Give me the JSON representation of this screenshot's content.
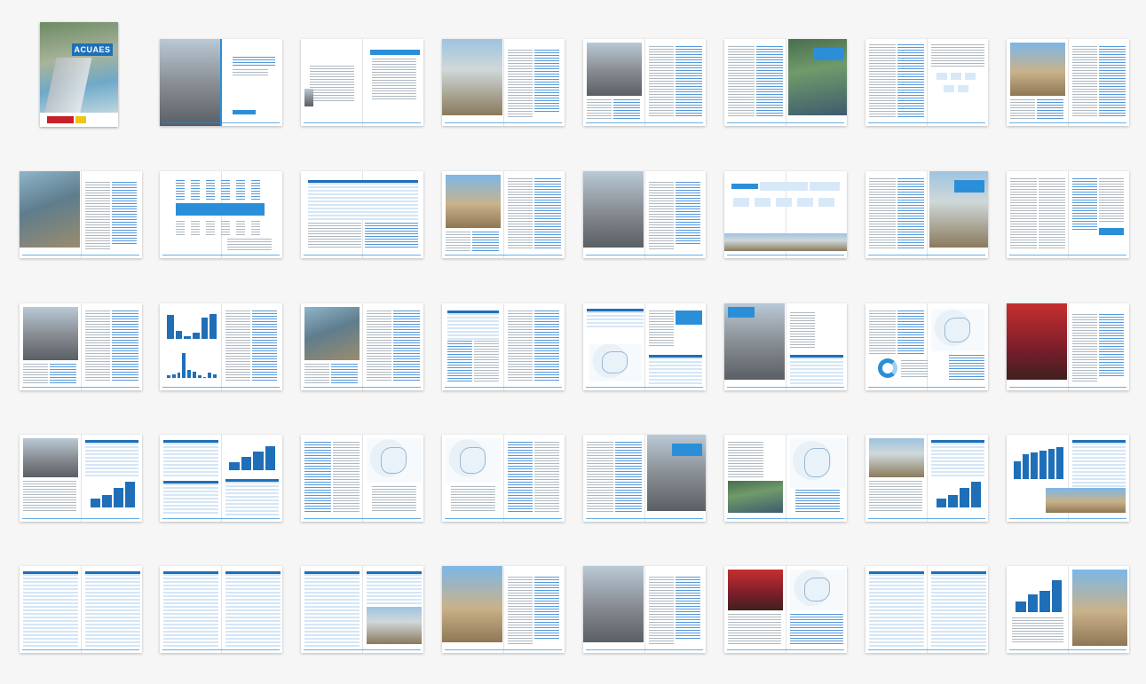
{
  "cover": {
    "logo_text": "ACUAES"
  },
  "spreads": [
    {
      "kind": "title"
    },
    {
      "kind": "toc"
    },
    {
      "kind": "photoText",
      "photo": "b"
    },
    {
      "kind": "photoLeft",
      "photo": "d"
    },
    {
      "kind": "textPhoto",
      "photo": "c"
    },
    {
      "kind": "diagram"
    },
    {
      "kind": "photoLeft",
      "photo": "e"
    },
    {
      "kind": "photoText",
      "photo": "a"
    },
    {
      "kind": "infographic"
    },
    {
      "kind": "bigTable"
    },
    {
      "kind": "photoLeft",
      "photo": "e"
    },
    {
      "kind": "photoText",
      "photo": "d"
    },
    {
      "kind": "orgChart"
    },
    {
      "kind": "textPhoto",
      "photo": "b"
    },
    {
      "kind": "textOnly"
    },
    {
      "kind": "photoLeft",
      "photo": "d"
    },
    {
      "kind": "barCharts"
    },
    {
      "kind": "photoLeft",
      "photo": "a"
    },
    {
      "kind": "tableText"
    },
    {
      "kind": "mapTable"
    },
    {
      "kind": "photoTable",
      "photo": "d"
    },
    {
      "kind": "mapDonut"
    },
    {
      "kind": "photoText",
      "photo": "f"
    },
    {
      "kind": "photoChart",
      "photo": "d"
    },
    {
      "kind": "tableChart"
    },
    {
      "kind": "textMap"
    },
    {
      "kind": "mapText"
    },
    {
      "kind": "textPhoto",
      "photo": "d"
    },
    {
      "kind": "mapPhoto",
      "photo": "c"
    },
    {
      "kind": "photoChart",
      "photo": "b"
    },
    {
      "kind": "chartTable"
    },
    {
      "kind": "tables"
    },
    {
      "kind": "tables"
    },
    {
      "kind": "tablePhoto",
      "photo": "b"
    },
    {
      "kind": "photoText",
      "photo": "e"
    },
    {
      "kind": "photoText",
      "photo": "d"
    },
    {
      "kind": "photoMap",
      "photo": "f"
    },
    {
      "kind": "tables"
    },
    {
      "kind": "chartPhoto",
      "photo": "e"
    }
  ]
}
